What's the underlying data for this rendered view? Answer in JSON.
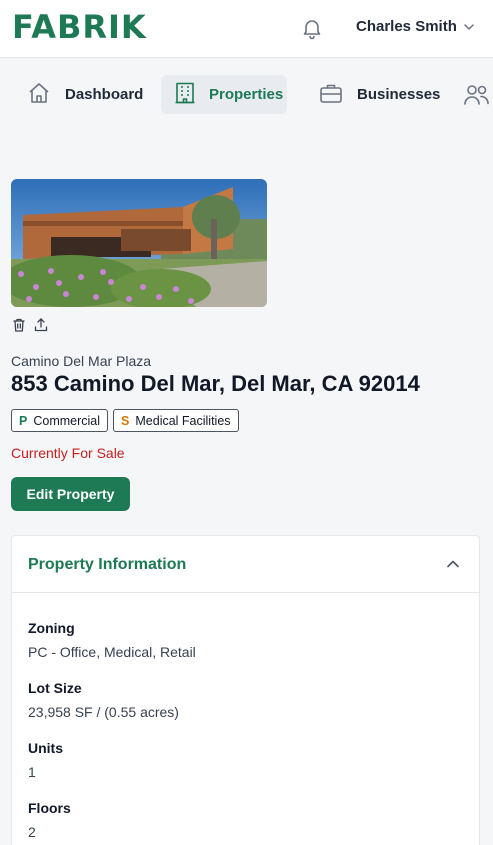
{
  "header": {
    "logo_text": "FABRIK",
    "user_name": "Charles Smith",
    "brand_color": "#1d7a55"
  },
  "nav": {
    "items": [
      {
        "label": "Dashboard",
        "icon": "home-icon",
        "active": false
      },
      {
        "label": "Properties",
        "icon": "building-icon",
        "active": true
      },
      {
        "label": "Businesses",
        "icon": "briefcase-icon",
        "active": false
      }
    ]
  },
  "property": {
    "name": "Camino Del Mar Plaza",
    "address": "853 Camino Del Mar, Del Mar, CA 92014",
    "tags": [
      {
        "letter": "P",
        "label": "Commercial",
        "letter_color": "#1d7a55"
      },
      {
        "letter": "S",
        "label": "Medical Facilities",
        "letter_color": "#d97706"
      }
    ],
    "status": "Currently For Sale",
    "status_color": "#c81e1e",
    "edit_label": "Edit Property"
  },
  "info_card": {
    "title": "Property Information",
    "fields": [
      {
        "label": "Zoning",
        "value": "PC - Office, Medical, Retail"
      },
      {
        "label": "Lot Size",
        "value": "23,958 SF / (0.55 acres)"
      },
      {
        "label": "Units",
        "value": "1"
      },
      {
        "label": "Floors",
        "value": "2"
      }
    ]
  }
}
